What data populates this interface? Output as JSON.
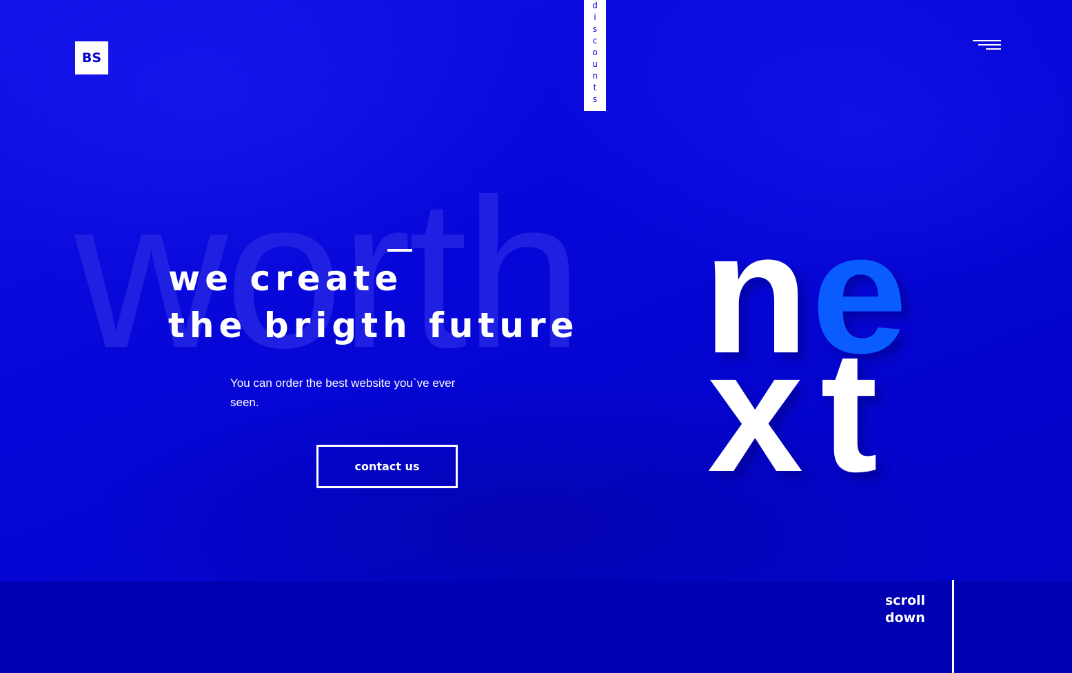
{
  "header": {
    "logo_text": "BS",
    "discounts_letters": [
      "d",
      "i",
      "s",
      "c",
      "o",
      "u",
      "n",
      "t",
      "s"
    ],
    "menu_icon": "hamburger-menu-icon"
  },
  "hero": {
    "background_word": "worth",
    "headline_line1": "we create",
    "headline_line2": "the brigth future",
    "subtitle": "You can order the best website you`ve ever seen.",
    "cta_label": "contact us",
    "big_letters": {
      "l1": "n",
      "l2": "e",
      "l3": "x",
      "l4": "t"
    }
  },
  "footer": {
    "scroll_line1": "scroll",
    "scroll_line2": "down"
  },
  "colors": {
    "background": "#0303d6",
    "bottom_bar": "#0000b3",
    "accent": "#0a5cff",
    "text": "#ffffff"
  }
}
